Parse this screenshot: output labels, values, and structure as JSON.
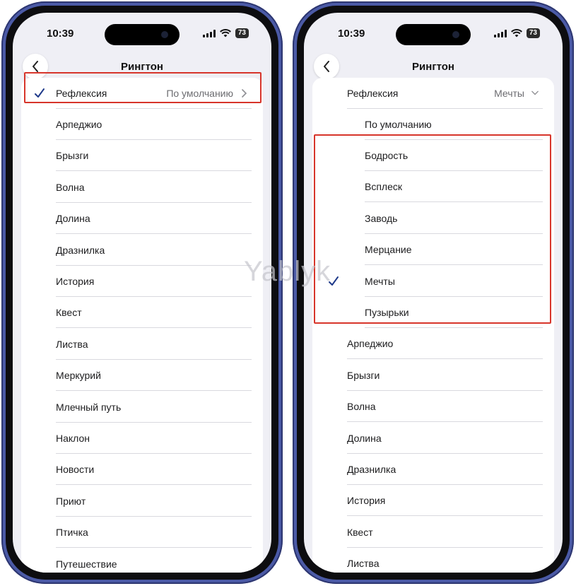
{
  "left": {
    "time": "10:39",
    "battery": "73",
    "title": "Рингтон",
    "selected": {
      "label": "Рефлексия",
      "detail": "По умолчанию"
    },
    "items": [
      "Арпеджио",
      "Брызги",
      "Волна",
      "Долина",
      "Дразнилка",
      "История",
      "Квест",
      "Листва",
      "Меркурий",
      "Млечный путь",
      "Наклон",
      "Новости",
      "Приют",
      "Птичка",
      "Путешествие"
    ]
  },
  "right": {
    "time": "10:39",
    "battery": "73",
    "title": "Рингтон",
    "selected": {
      "label": "Рефлексия",
      "detail": "Мечты"
    },
    "sub_default": "По умолчанию",
    "sub_items": [
      "Бодрость",
      "Всплеск",
      "Заводь",
      "Мерцание",
      "Мечты",
      "Пузырьки"
    ],
    "items": [
      "Арпеджио",
      "Брызги",
      "Волна",
      "Долина",
      "Дразнилка",
      "История",
      "Квест",
      "Листва"
    ]
  },
  "watermark": "Yablyk",
  "colors": {
    "highlight": "#d7352b",
    "accent": "#1f3a8a",
    "phone_frame": "#4b5aa6"
  }
}
